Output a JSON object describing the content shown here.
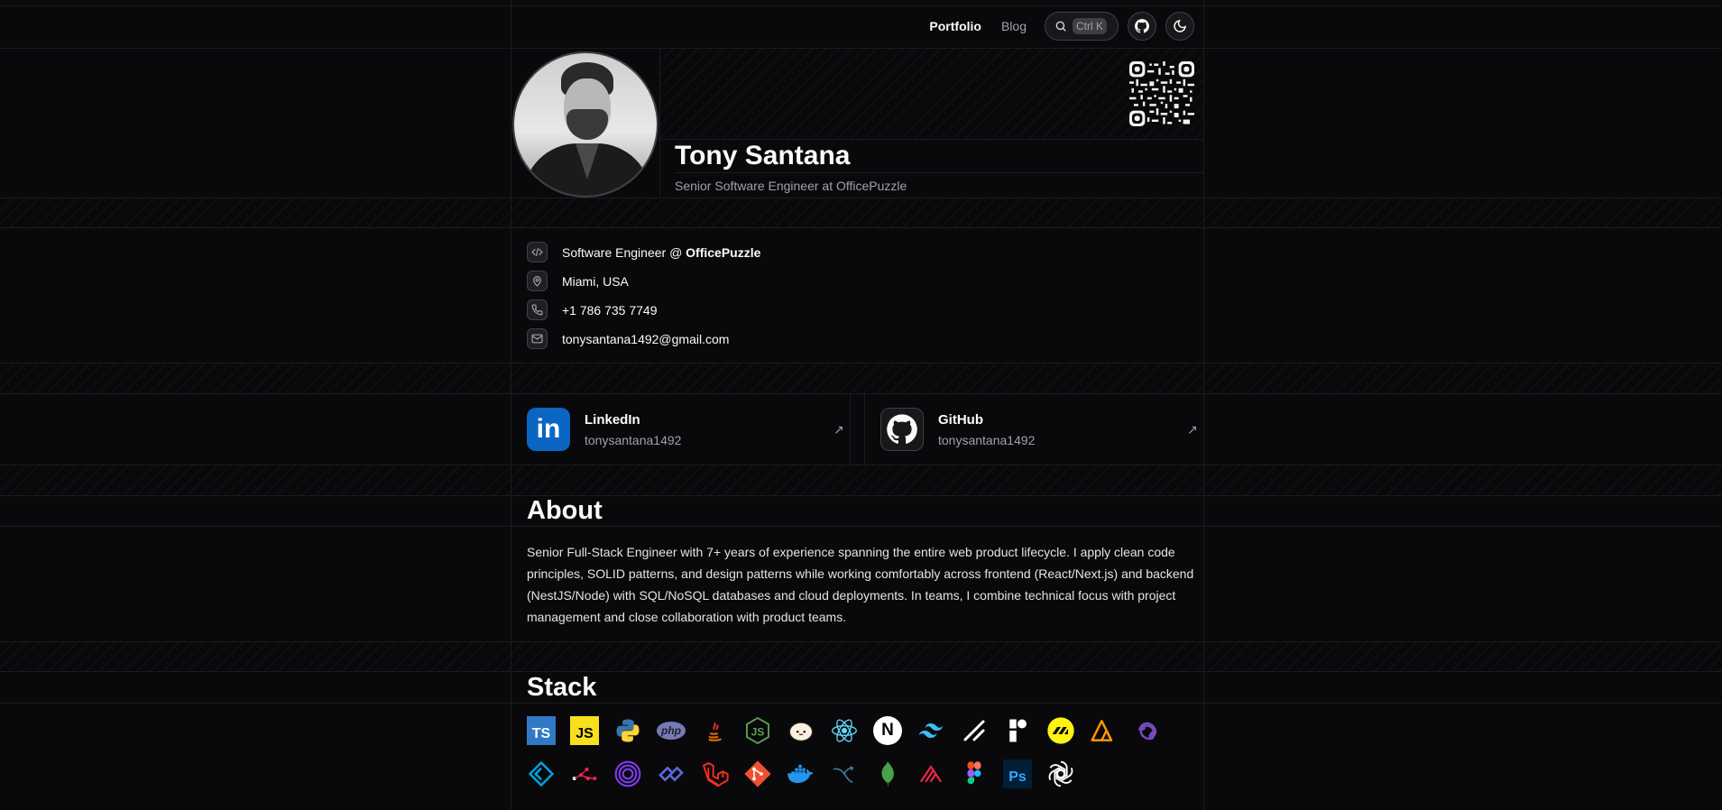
{
  "nav": {
    "portfolio": "Portfolio",
    "blog": "Blog",
    "search_shortcut": "Ctrl K"
  },
  "profile": {
    "name": "Tony Santana",
    "title": "Senior Software Engineer at OfficePuzzle"
  },
  "info": {
    "role_prefix": "Software Engineer @ ",
    "company": "OfficePuzzle",
    "location": "Miami, USA",
    "phone": "+1 786 735 7749",
    "email": "tonysantana1492@gmail.com"
  },
  "social": {
    "linkedin": {
      "title": "LinkedIn",
      "handle": "tonysantana1492",
      "color": "#0a66c2"
    },
    "github": {
      "title": "GitHub",
      "handle": "tonysantana1492"
    }
  },
  "about": {
    "heading": "About",
    "text": "Senior Full-Stack Engineer with 7+ years of experience spanning the entire web product lifecycle. I apply clean code principles, SOLID patterns, and design patterns while working comfortably across frontend (React/Next.js) and backend (NestJS/Node) with SQL/NoSQL databases and cloud deployments. In teams, I combine technical focus with project management and close collaboration with product teams."
  },
  "stack": {
    "heading": "Stack",
    "items": [
      {
        "icon": "typescript-icon",
        "label": "TS",
        "bg": "#3178c6",
        "fg": "#ffffff"
      },
      {
        "icon": "javascript-icon",
        "label": "JS",
        "bg": "#f7df1e",
        "fg": "#000000"
      },
      {
        "icon": "python-icon",
        "label": "",
        "bg": "",
        "fg": ""
      },
      {
        "icon": "php-icon",
        "label": "php",
        "bg": "#777bb3",
        "fg": "#1f1f2e"
      },
      {
        "icon": "java-icon",
        "label": "",
        "bg": "",
        "fg": ""
      },
      {
        "icon": "nodejs-icon",
        "label": "JS",
        "bg": "",
        "fg": "#5fa04e"
      },
      {
        "icon": "bun-icon",
        "label": "",
        "bg": "",
        "fg": ""
      },
      {
        "icon": "react-icon",
        "label": "",
        "bg": "",
        "fg": "#61dafb"
      },
      {
        "icon": "nextjs-icon",
        "label": "N",
        "bg": "#ffffff",
        "fg": "#000000"
      },
      {
        "icon": "tailwind-icon",
        "label": "",
        "bg": "",
        "fg": "#38bdf8"
      },
      {
        "icon": "shadcn-icon",
        "label": "",
        "bg": "",
        "fg": "#ffffff"
      },
      {
        "icon": "radix-icon",
        "label": "",
        "bg": "",
        "fg": "#ffffff"
      },
      {
        "icon": "motion-icon",
        "label": "",
        "bg": "#fff312",
        "fg": "#000000"
      },
      {
        "icon": "aws-amplify-icon",
        "label": "",
        "bg": "",
        "fg": "#ff9900"
      },
      {
        "icon": "redux-icon",
        "label": "",
        "bg": "",
        "fg": "#764abc"
      },
      {
        "icon": "tanstack-icon",
        "label": "",
        "bg": "",
        "fg": "#00a3e0"
      },
      {
        "icon": "turborepo-icon",
        "label": "",
        "bg": "",
        "fg": "#ff1e56"
      },
      {
        "icon": "socketio-icon",
        "label": "",
        "bg": "",
        "fg": "#7c3aed"
      },
      {
        "icon": "prisma-icon",
        "label": "",
        "bg": "",
        "fg": "#5a67d8"
      },
      {
        "icon": "laravel-icon",
        "label": "",
        "bg": "",
        "fg": "#ff2d20"
      },
      {
        "icon": "git-icon",
        "label": "",
        "bg": "#f05032",
        "fg": "#ffffff"
      },
      {
        "icon": "docker-icon",
        "label": "",
        "bg": "",
        "fg": "#2496ed"
      },
      {
        "icon": "mysql-icon",
        "label": "",
        "bg": "",
        "fg": "#4479a1"
      },
      {
        "icon": "mongodb-icon",
        "label": "",
        "bg": "",
        "fg": "#47a248"
      },
      {
        "icon": "nestjs-icon",
        "label": "",
        "bg": "",
        "fg": "#ea2845"
      },
      {
        "icon": "figma-icon",
        "label": "",
        "bg": "",
        "fg": ""
      },
      {
        "icon": "photoshop-icon",
        "label": "Ps",
        "bg": "#001e36",
        "fg": "#31a8ff"
      },
      {
        "icon": "openai-icon",
        "label": "",
        "bg": "",
        "fg": "#ffffff"
      }
    ]
  },
  "colors": {
    "background": "#09090b",
    "grid_line": "#1c1c20",
    "muted_text": "#a1a1aa"
  }
}
